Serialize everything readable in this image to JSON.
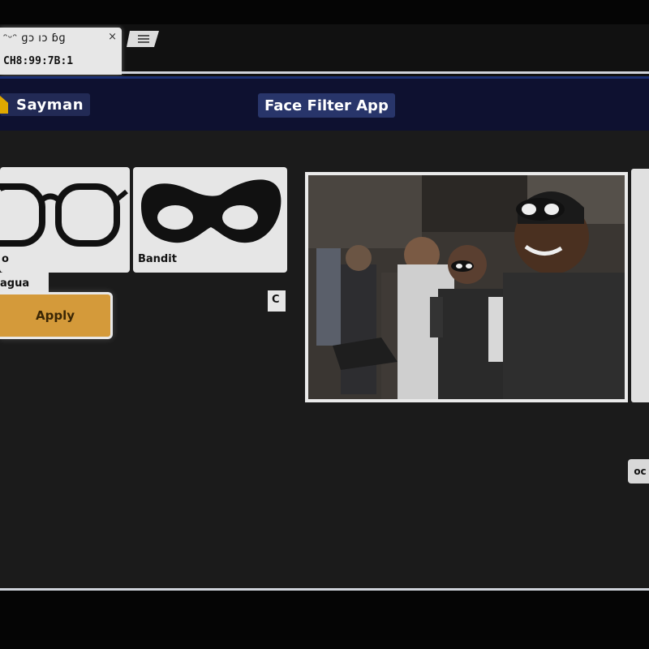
{
  "browser": {
    "tab_title": "ᵔᵕᵔ ɡɔ ıɔ ɓɡ",
    "tab_url": "CH8:99:7B:1",
    "tab_close_icon": "×",
    "new_tab_icon": "new-tab-icon"
  },
  "navbar": {
    "brand_label": "Sayman",
    "app_title": "Face Filter App"
  },
  "filters": {
    "items": [
      {
        "icon": "glasses-icon",
        "label": "o"
      },
      {
        "icon": "mask-icon",
        "label": "Bandit"
      }
    ],
    "sub_label": "agua",
    "mini_tag": "C",
    "apply_button": "Apply"
  },
  "camera": {
    "icon": "camera-preview"
  },
  "corner_badge": "oc",
  "colors": {
    "navbar_bg": "#0e1130",
    "accent_button": "#d49a3a",
    "card_bg": "#e6e6e6"
  }
}
